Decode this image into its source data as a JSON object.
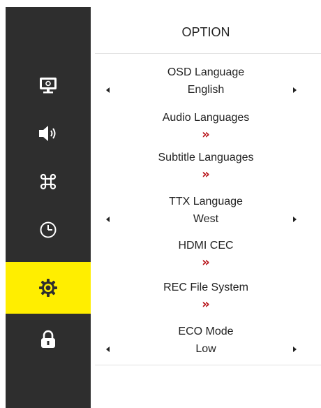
{
  "sidebar": {
    "items": [
      {
        "icon": "monitor-icon",
        "active": false
      },
      {
        "icon": "speaker-icon",
        "active": false
      },
      {
        "icon": "command-icon",
        "active": false
      },
      {
        "icon": "clock-icon",
        "active": false
      },
      {
        "icon": "gear-icon",
        "active": true
      },
      {
        "icon": "lock-icon",
        "active": false
      }
    ],
    "colors": {
      "background": "#2e2e2e",
      "active": "#ffee00"
    }
  },
  "header": {
    "title": "OPTION"
  },
  "options": [
    {
      "label": "OSD Language",
      "value": "English",
      "type": "select"
    },
    {
      "label": "Audio Languages",
      "value": "»",
      "type": "submenu"
    },
    {
      "label": "Subtitle Languages",
      "value": "»",
      "type": "submenu"
    },
    {
      "label": "TTX Language",
      "value": "West",
      "type": "select"
    },
    {
      "label": "HDMI CEC",
      "value": "»",
      "type": "submenu"
    },
    {
      "label": "REC File System",
      "value": "»",
      "type": "submenu"
    },
    {
      "label": "ECO Mode",
      "value": "Low",
      "type": "select"
    }
  ],
  "colors": {
    "submenu_chevron": "#b8141a",
    "text": "#222222"
  }
}
